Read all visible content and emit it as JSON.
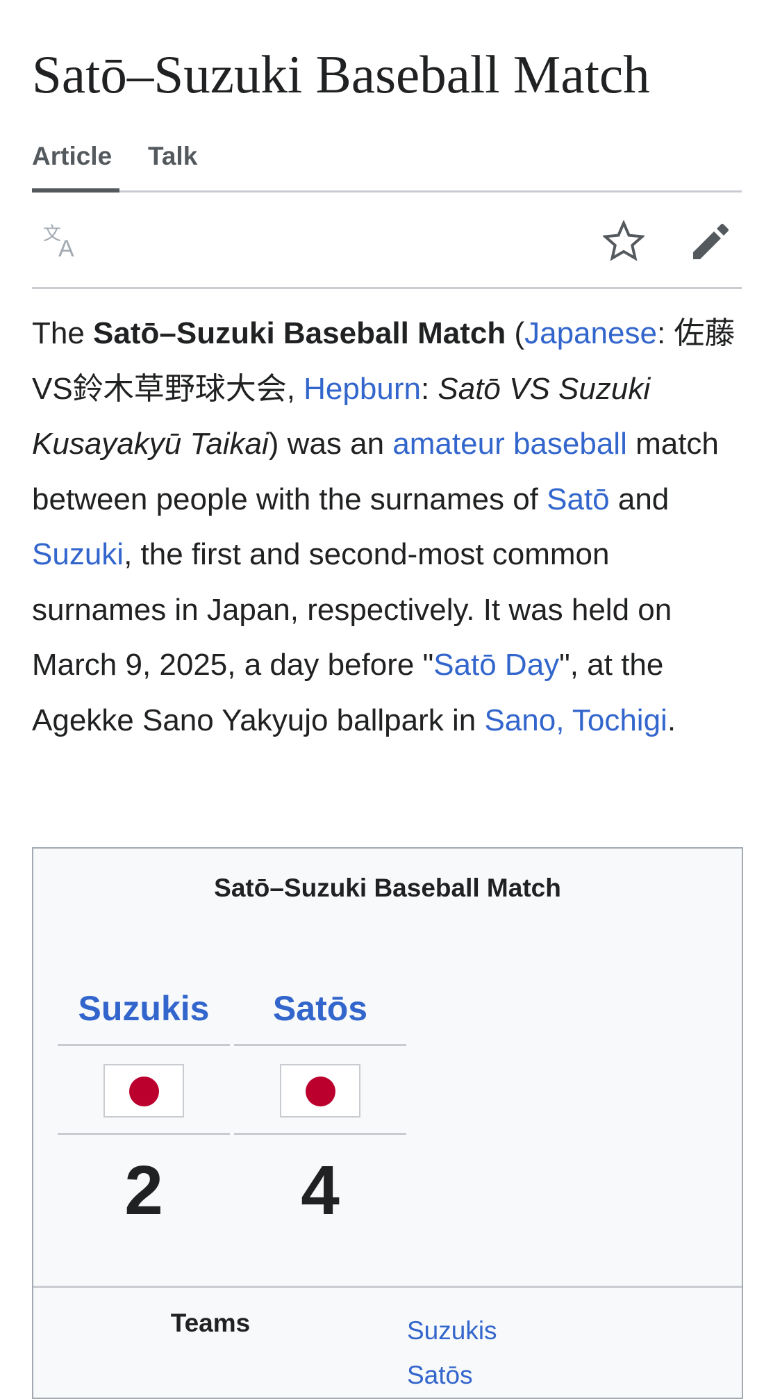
{
  "page": {
    "title": "Satō–Suzuki Baseball Match"
  },
  "tabs": [
    {
      "label": "Article",
      "selected": true
    },
    {
      "label": "Talk",
      "selected": false
    }
  ],
  "toolbar": {
    "icons": [
      "language-icon",
      "star-icon",
      "pencil-icon"
    ]
  },
  "lead": {
    "t1": "The ",
    "bold": "Satō–Suzuki Baseball Match",
    "t2": " (",
    "link_japanese": "Japanese",
    "t3": ": 佐藤VS鈴木草野球大会, ",
    "link_hepburn": "Hepburn",
    "t4": ": ",
    "italic": "Satō VS Suzuki Kusayakyū Taikai",
    "t5": ") was an ",
    "link_amateur_baseball": "amateur baseball",
    "t6": " match between people with the surnames of ",
    "link_sato": "Satō",
    "t7": " and ",
    "link_suzuki": "Suzuki",
    "t8": ", the first and second-most common surnames in Japan, respectively. It was held on March 9, 2025, a day before \"",
    "link_sato_day": "Satō Day",
    "t9": "\", at the Agekke Sano Yakyujo ballpark in ",
    "link_sano": "Sano, Tochigi",
    "t10": "."
  },
  "infobox": {
    "title": "Satō–Suzuki Baseball Match",
    "teams": [
      {
        "name": "Suzukis",
        "score": "2",
        "flag": "japan-flag"
      },
      {
        "name": "Satōs",
        "score": "4",
        "flag": "japan-flag"
      }
    ],
    "teams_label": "Teams",
    "teams_links": [
      "Suzukis",
      "Satōs"
    ]
  },
  "colors": {
    "link": "#3366cc",
    "text": "#202122",
    "infobox_bg": "#f8f9fa",
    "flag_red": "#bc002d"
  }
}
